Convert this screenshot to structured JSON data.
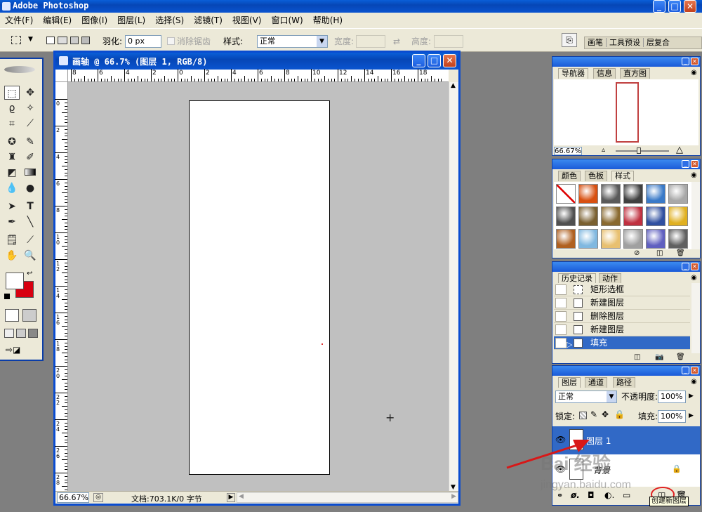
{
  "app": {
    "title": "Adobe Photoshop"
  },
  "menu": [
    "文件(F)",
    "编辑(E)",
    "图像(I)",
    "图层(L)",
    "选择(S)",
    "滤镜(T)",
    "视图(V)",
    "窗口(W)",
    "帮助(H)"
  ],
  "options": {
    "feather_label": "羽化:",
    "feather_value": "0 px",
    "antialias_label": "消除锯齿",
    "style_label": "样式:",
    "style_value": "正常",
    "width_label": "宽度:",
    "height_label": "高度:",
    "palette_well": [
      "画笔",
      "工具预设",
      "层复合"
    ]
  },
  "document": {
    "title": "画轴 @ 66.7% (图层 1, RGB/8)",
    "zoom": "66.67%",
    "doc_info": "文档:703.1K/0 字节",
    "ruler_h": [
      "8",
      "6",
      "4",
      "2",
      "0",
      "2",
      "4",
      "6",
      "8",
      "10",
      "12",
      "14",
      "16",
      "18"
    ],
    "ruler_v": [
      "0",
      "2",
      "4",
      "6",
      "8",
      "10",
      "12",
      "14",
      "16",
      "18",
      "20",
      "22",
      "24",
      "26",
      "28"
    ]
  },
  "navigator": {
    "tabs": [
      "导航器",
      "信息",
      "直方图"
    ],
    "zoom": "66.67%"
  },
  "swatches": {
    "tabs": [
      "颜色",
      "色板",
      "样式"
    ],
    "styles": [
      "#e8e8e8",
      "#d85010",
      "#5a5a5a",
      "#404040",
      "#3a7ac8",
      "#a8a8a8",
      "#505050",
      "#7a6030",
      "#8a6a30",
      "#c03040",
      "#3050a0",
      "#e0b020",
      "#b06020",
      "#80b8e0",
      "#e8c070",
      "#a0a0a0",
      "#6060c0",
      "#606060"
    ]
  },
  "history": {
    "tabs": [
      "历史记录",
      "动作"
    ],
    "items": [
      "矩形选框",
      "新建图层",
      "删除图层",
      "新建图层",
      "填充"
    ]
  },
  "layers": {
    "tabs": [
      "图层",
      "通道",
      "路径"
    ],
    "blend_mode": "正常",
    "opacity_label": "不透明度:",
    "opacity_value": "100%",
    "lock_label": "锁定:",
    "fill_label": "填充:",
    "fill_value": "100%",
    "items": [
      {
        "name": "图层 1",
        "selected": true
      },
      {
        "name": "背景",
        "selected": false
      }
    ],
    "tooltip": "创建新图层"
  },
  "watermark": {
    "brand": "Bai 经验",
    "url": "jingyan.baidu.com"
  }
}
